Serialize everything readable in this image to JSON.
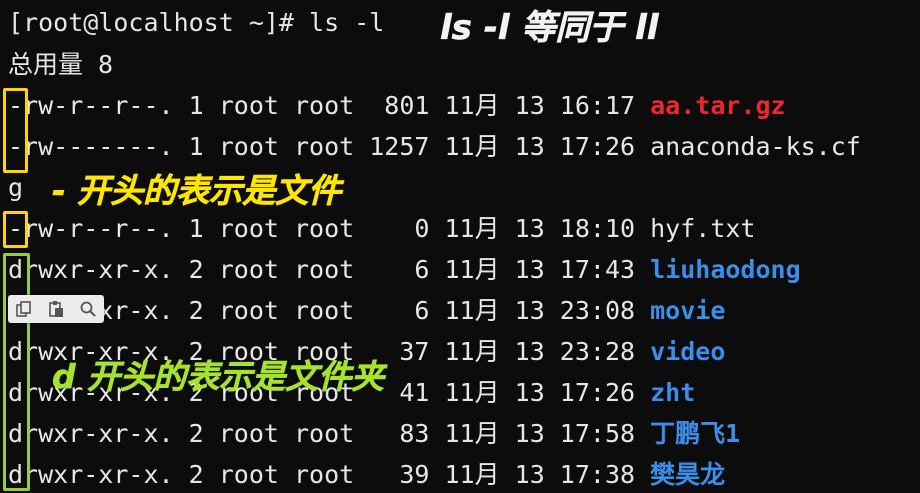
{
  "terminal": {
    "prompt": "[root@localhost ~]# ls -l",
    "total": "总用量 8",
    "listing": [
      {
        "perm": "-rw-r--r--.",
        "links": "1",
        "owner": "root",
        "group": "root",
        "size": "801",
        "month": "11月",
        "day": "13",
        "time": "16:17",
        "name": "aa.tar.gz",
        "color": "#f0262d"
      },
      {
        "perm": "-rw-------.",
        "links": "1",
        "owner": "root",
        "group": "root",
        "size": "1257",
        "month": "11月",
        "day": "13",
        "time": "17:26",
        "name": "anaconda-ks.cf",
        "color": "#e6e6e6"
      },
      {
        "wrap": "g"
      },
      {
        "perm": "-rw-r--r--.",
        "links": "1",
        "owner": "root",
        "group": "root",
        "size": "0",
        "month": "11月",
        "day": "13",
        "time": "18:10",
        "name": "hyf.txt",
        "color": "#e6e6e6"
      },
      {
        "perm": "drwxr-xr-x.",
        "links": "2",
        "owner": "root",
        "group": "root",
        "size": "6",
        "month": "11月",
        "day": "13",
        "time": "17:43",
        "name": "liuhaodong",
        "color": "#3b8eea"
      },
      {
        "perm": "drwxr-xr-x.",
        "links": "2",
        "owner": "root",
        "group": "root",
        "size": "6",
        "month": "11月",
        "day": "13",
        "time": "23:08",
        "name": "movie",
        "color": "#3b8eea"
      },
      {
        "perm": "drwxr-xr-x.",
        "links": "2",
        "owner": "root",
        "group": "root",
        "size": "37",
        "month": "11月",
        "day": "13",
        "time": "23:28",
        "name": "video",
        "color": "#3b8eea"
      },
      {
        "perm": "drwxr-xr-x.",
        "links": "2",
        "owner": "root",
        "group": "root",
        "size": "41",
        "month": "11月",
        "day": "13",
        "time": "17:26",
        "name": "zht",
        "color": "#3b8eea"
      },
      {
        "perm": "drwxr-xr-x.",
        "links": "2",
        "owner": "root",
        "group": "root",
        "size": "83",
        "month": "11月",
        "day": "13",
        "time": "17:58",
        "name": "丁鹏飞1",
        "color": "#3b8eea"
      },
      {
        "perm": "drwxr-xr-x.",
        "links": "2",
        "owner": "root",
        "group": "root",
        "size": "39",
        "month": "11月",
        "day": "13",
        "time": "17:38",
        "name": "樊昊龙",
        "color": "#3b8eea"
      }
    ]
  },
  "annotations": {
    "title": "ls -l 等同于 ll",
    "file_note": "- 开头的表示是文件",
    "dir_note": "d 开头的表示是文件夹"
  },
  "colors": {
    "background": "#0c0c0c",
    "text": "#e6e6e6",
    "archive": "#f0262d",
    "directory": "#3b8eea",
    "highlight_yellow": "#ffd400",
    "highlight_green": "#9acd32"
  },
  "toolbar": {
    "icons": [
      "copy-icon",
      "paste-icon",
      "search-icon"
    ]
  }
}
